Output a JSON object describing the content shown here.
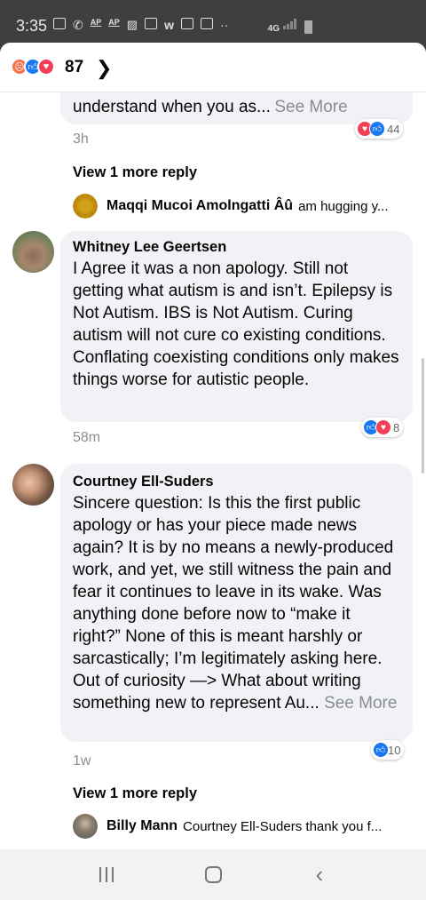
{
  "status_bar": {
    "time": "3:35",
    "ap1": "AP",
    "ap2": "AP",
    "network": "4G"
  },
  "header": {
    "reaction_count": "87",
    "reaction_types": [
      "angry",
      "like",
      "love"
    ]
  },
  "comments": [
    {
      "body_tail": "understand when you as...",
      "see_more": "See More",
      "time": "3h",
      "reaction_count": "44",
      "reactions": [
        "love",
        "like"
      ],
      "view_more": "View 1 more reply",
      "reply_name": "Maqqi Mucoi Amolngatti Âû",
      "reply_text": "am hugging y..."
    },
    {
      "name": "Whitney Lee Geertsen",
      "body": "I Agree it was a non apology. Still not getting what autism is and isn’t. Epilepsy is Not Autism. IBS is Not Autism. Curing autism will not cure co existing conditions. Conflating coexisting conditions only makes things worse for autistic people.",
      "time": "58m",
      "reaction_count": "8",
      "reactions": [
        "like",
        "love"
      ]
    },
    {
      "name": "Courtney Ell-Suders",
      "body": "Sincere question: Is this the first public apology or has your piece made news again? It is by no means a newly-produced work, and yet, we still witness the pain and fear it continues to leave in its wake. Was anything done before now to “make it right?” None of this is meant harshly or sarcastically; I’m legitimately asking here. Out of curiosity —> What about writing something new to represent Au...",
      "see_more": "See More",
      "time": "1w",
      "reaction_count": "10",
      "reactions": [
        "like"
      ],
      "view_more": "View 1 more reply",
      "reply_name": "Billy Mann",
      "reply_text": "Courtney Ell-Suders  thank you f..."
    }
  ],
  "colors": {
    "like": "#1877f2",
    "love": "#f33e58",
    "angry": "#f7714c",
    "bubble": "#f0f2f5",
    "secondary_text": "#8a8d91"
  }
}
